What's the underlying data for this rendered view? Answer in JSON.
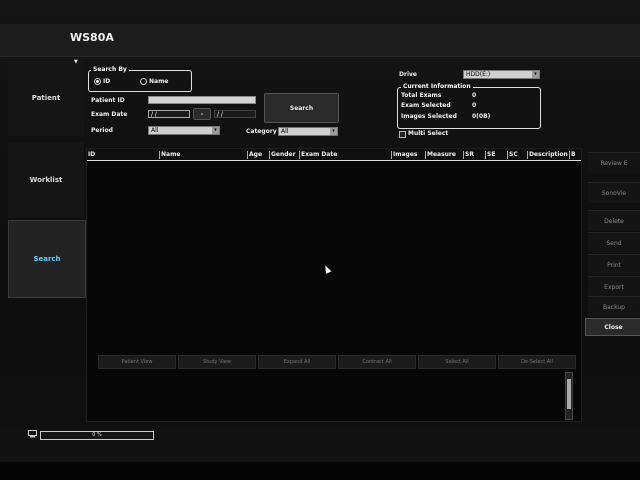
{
  "app": {
    "title": "WS80A"
  },
  "nav": [
    {
      "label": "Patient",
      "active": false
    },
    {
      "label": "Worklist",
      "active": false
    },
    {
      "label": "Search",
      "active": true
    }
  ],
  "search": {
    "search_by_legend": "Search By",
    "radio_id": "ID",
    "radio_name": "Name",
    "patient_id_label": "Patient ID",
    "patient_id_value": "",
    "exam_date_label": "Exam Date",
    "exam_date_from": "/ /",
    "exam_date_sep": "-",
    "exam_date_to": "/ /",
    "period_label": "Period",
    "period_value": "All",
    "category_label": "Category",
    "category_value": "All",
    "search_button": "Search"
  },
  "info": {
    "drive_label": "Drive",
    "drive_value": "HDD(E:)",
    "current_info_legend": "Current Information",
    "total_exams_label": "Total Exams",
    "total_exams_value": "0",
    "exam_selected_label": "Exam Selected",
    "exam_selected_value": "0",
    "images_selected_label": "Images Selected",
    "images_selected_value": "0(0B)",
    "multi_select_label": "Multi Select"
  },
  "table": {
    "columns": [
      "ID",
      "Name",
      "Age",
      "Gender",
      "Exam Date",
      "Images",
      "Measure",
      "SR",
      "SE",
      "SC",
      "Description",
      "B"
    ]
  },
  "bottom_buttons": [
    "Patient View",
    "Study View",
    "Expand All",
    "Contract All",
    "Select All",
    "De-Select All"
  ],
  "side_buttons": [
    "Review E",
    "SonoVie",
    "Delete",
    "Send",
    "Print",
    "Export",
    "Backup"
  ],
  "close_button": "Close",
  "status": {
    "progress_text": "0 %",
    "progress": 0.0
  }
}
